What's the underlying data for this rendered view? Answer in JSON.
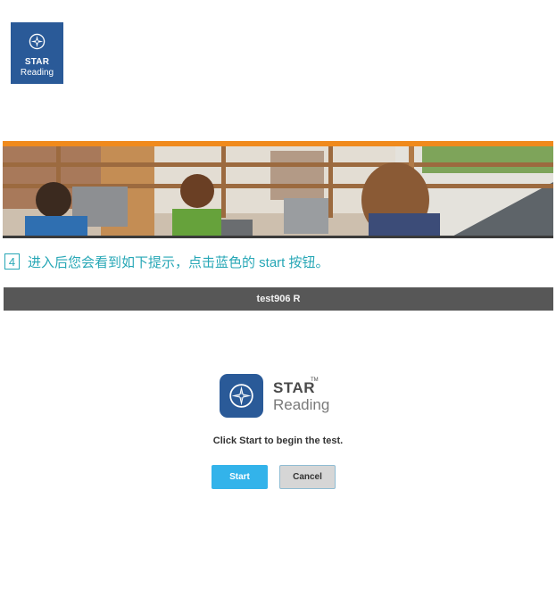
{
  "corner_logo": {
    "line1": "STAR",
    "line2": "Reading"
  },
  "step": {
    "number": "4",
    "text": "进入后您会看到如下提示，点击蓝色的 start 按钮。"
  },
  "titlebar": {
    "text": "test906 R"
  },
  "app_logo": {
    "brand": "STAR",
    "trademark": "TM",
    "product": "Reading"
  },
  "prompt": {
    "text": "Click Start to begin the test."
  },
  "buttons": {
    "start": "Start",
    "cancel": "Cancel"
  },
  "colors": {
    "brand_blue": "#2a5a98",
    "accent_orange": "#f08a1c",
    "step_teal": "#27a7b6",
    "start_blue": "#33b3ea",
    "titlebar_grey": "#575757"
  },
  "icons": {
    "logo": "compass-icon"
  }
}
